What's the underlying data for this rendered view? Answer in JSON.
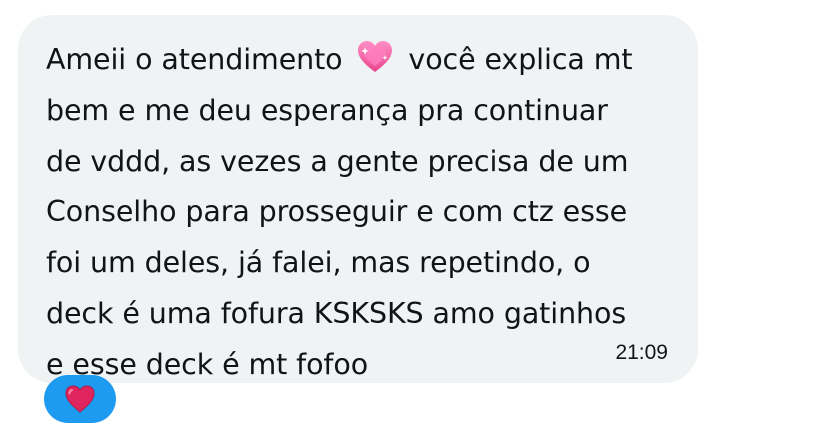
{
  "message": {
    "text_before_emoji": "Ameii o atendimento",
    "emoji_icon": "sparkling-heart-icon",
    "text_after_emoji": "você explica mt\nbem e me deu esperança pra continuar\nde vddd, as vezes a gente precisa de um\nConselho para prosseguir e com ctz esse\nfoi um deles, já falei, mas repetindo, o\ndeck é uma fofura KSKSKS amo gatinhos\ne esse deck é mt fofoo",
    "timestamp": "21:09"
  },
  "reaction": {
    "icon": "red-heart-icon",
    "color": "#1d9bf0"
  },
  "colors": {
    "bubble": "#eff3f4",
    "text": "#0f1419",
    "heart_red": "#e0245e",
    "sparkle_pink": "#f06292"
  }
}
